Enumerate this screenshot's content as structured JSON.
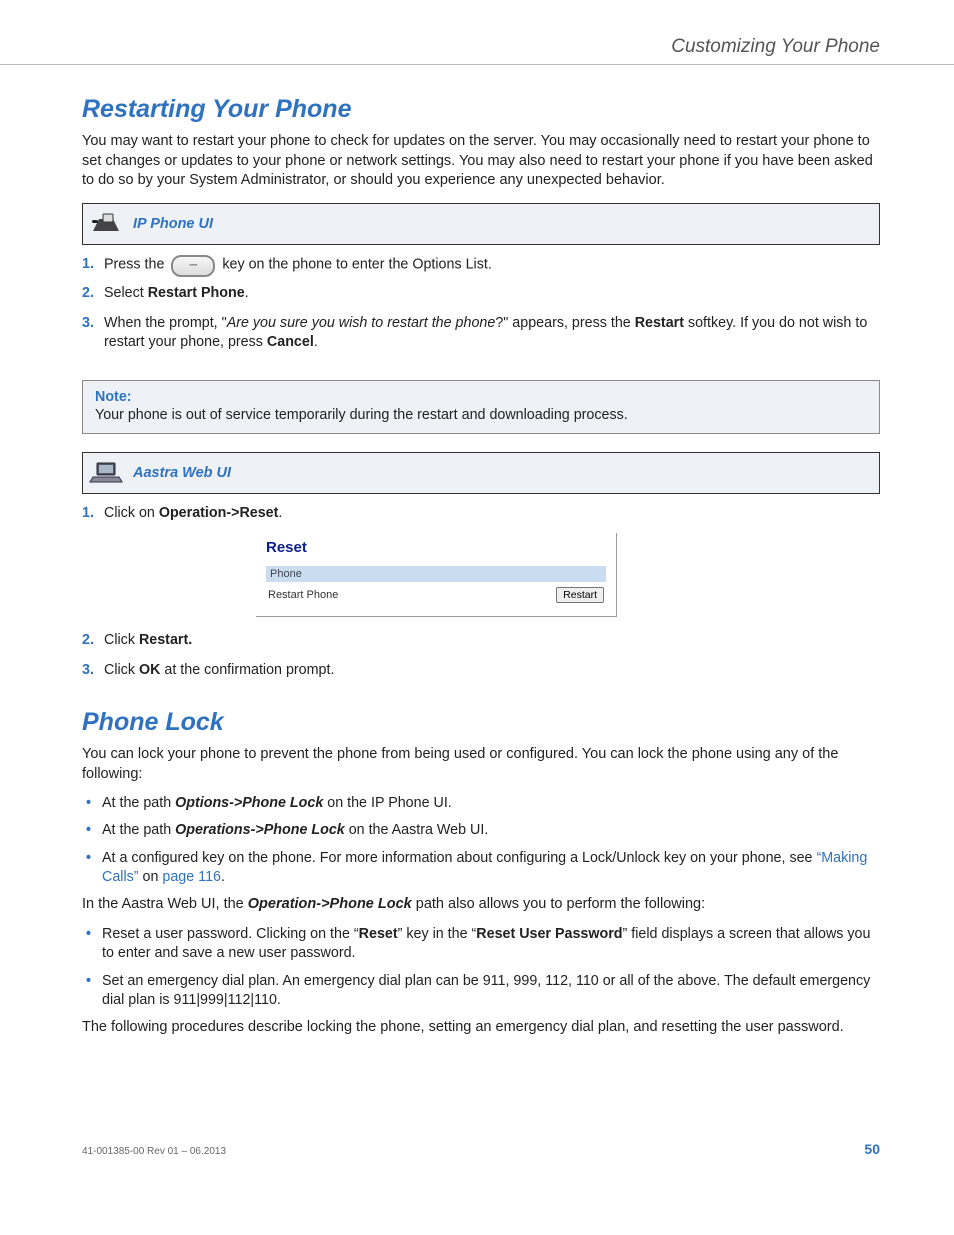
{
  "header": {
    "running": "Customizing Your Phone"
  },
  "section1": {
    "title": "Restarting Your Phone",
    "intro": "You may want to restart your phone to check for updates on the server. You may occasionally need to restart your phone to set changes or updates to your phone or network settings.   You may also need to restart your phone if you have been asked to do so by your System Administrator, or should you experience any unexpected behavior.",
    "ip_label": "IP Phone UI",
    "steps_ip": {
      "s1a": "Press the ",
      "s1b": " key on the phone to enter the Options List.",
      "s2a": "Select ",
      "s2b": "Restart Phone",
      "s2c": ".",
      "s3a": "When the prompt, \"",
      "s3b": "Are you sure you wish to restart the phone",
      "s3c": "?\" appears, press the ",
      "s3d": "Restart",
      "s3e": " softkey. If you do not wish to restart your phone, press ",
      "s3f": "Cancel",
      "s3g": "."
    },
    "note_head": "Note:",
    "note_body": "Your phone is out of service temporarily during the restart and downloading process.",
    "web_label": "Aastra Web UI",
    "steps_web": {
      "s1a": "Click on ",
      "s1b": "Operation->Reset",
      "s1c": ".",
      "s2a": "Click ",
      "s2b": "Restart.",
      "s3a": "Click ",
      "s3b": "OK",
      "s3c": " at the confirmation prompt."
    },
    "reset_pane": {
      "title": "Reset",
      "section": "Phone",
      "row_label": "Restart Phone",
      "button": "Restart"
    }
  },
  "section2": {
    "title": "Phone Lock",
    "intro": "You can lock your phone to prevent the phone from being used or configured. You can lock the phone using any of the following:",
    "b1a": "At the path ",
    "b1b": "Options->Phone Lock",
    "b1c": " on the IP Phone UI.",
    "b2a": "At the path ",
    "b2b": "Operations->Phone Lock",
    "b2c": " on the Aastra Web UI.",
    "b3a": "At a configured key on the phone. For more information about configuring a Lock/Unlock key on your phone, see ",
    "b3b": "“Making Calls”",
    "b3c": " on ",
    "b3d": "page 116",
    "b3e": ".",
    "mid_a": "In the Aastra Web UI, the ",
    "mid_b": "Operation->Phone Lock",
    "mid_c": " path also allows you to perform the following:",
    "b4a": "Reset a user password. Clicking on the “",
    "b4b": "Reset",
    "b4c": "” key in the “",
    "b4d": "Reset User Password",
    "b4e": "” field displays a screen that allows you to enter and save a new user password.",
    "b5": "Set an emergency dial plan. An emergency dial plan can be 911, 999, 112, 110 or all of the above. The default emergency dial plan is 911|999|112|110.",
    "outro": "The following procedures describe locking the phone, setting an emergency dial plan, and resetting the user password."
  },
  "footer": {
    "rev": "41-001385-00 Rev 01 – 06.2013",
    "page": "50"
  }
}
